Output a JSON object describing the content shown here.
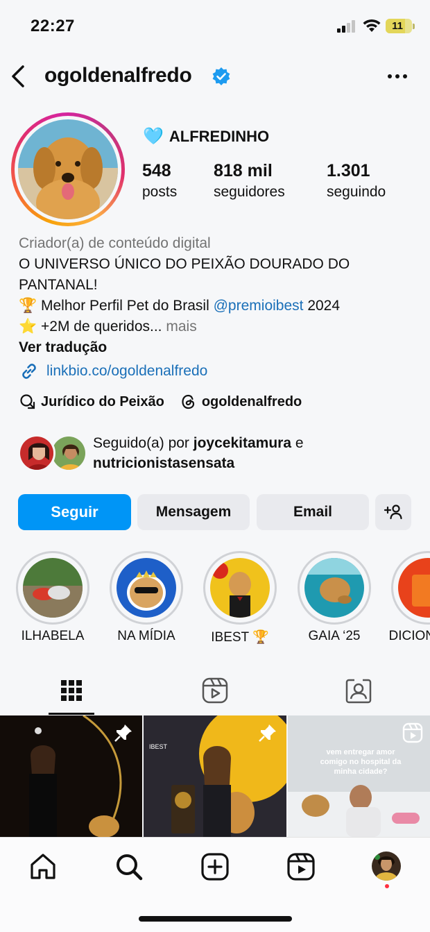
{
  "status_bar": {
    "time": "22:27",
    "battery": "11"
  },
  "header": {
    "username": "ogoldenalfredo"
  },
  "profile": {
    "display_name": "ALFREDINHO",
    "stats": [
      {
        "value": "548",
        "label": "posts"
      },
      {
        "value": "818 mil",
        "label": "seguidores"
      },
      {
        "value": "1.301",
        "label": "seguindo"
      }
    ],
    "category": "Criador(a) de conteúdo digital",
    "bio_line1": "O UNIVERSO ÚNICO DO PEIXÃO DOURADO DO",
    "bio_line2": "PANTANAL!",
    "bio_line3_pre": "Melhor Perfil Pet do Brasil",
    "bio_line3_mention": "@premioibest",
    "bio_line3_post": "2024",
    "bio_line4": "+2M de queridos...",
    "bio_more": "mais",
    "translate": "Ver tradução",
    "link": "linkbio.co/ogoldenalfredo",
    "extra_links": [
      {
        "label": "Jurídico do Peixão",
        "icon": "chat-icon"
      },
      {
        "label": "ogoldenalfredo",
        "icon": "threads-icon"
      }
    ]
  },
  "followed_by": {
    "prefix": "Seguido(a) por",
    "user1": "joycekitamura",
    "conj": "e",
    "user2": "nutricionistasensata"
  },
  "buttons": {
    "follow": "Seguir",
    "message": "Mensagem",
    "email": "Email"
  },
  "highlights": [
    {
      "label": "ILHABELA"
    },
    {
      "label": "NA MÍDIA"
    },
    {
      "label": "IBEST 🏆"
    },
    {
      "label": "GAIA ‘25"
    },
    {
      "label": "DICIONÁRIO"
    }
  ],
  "posts": [
    {
      "type": "pinned"
    },
    {
      "type": "pinned"
    },
    {
      "type": "reel",
      "overlay": "vem entregar amor comigo no hospital da minha cidade?"
    }
  ],
  "colors": {
    "accent": "#0095f6",
    "link": "#1a6fb8",
    "verified": "#1d9bf0"
  }
}
